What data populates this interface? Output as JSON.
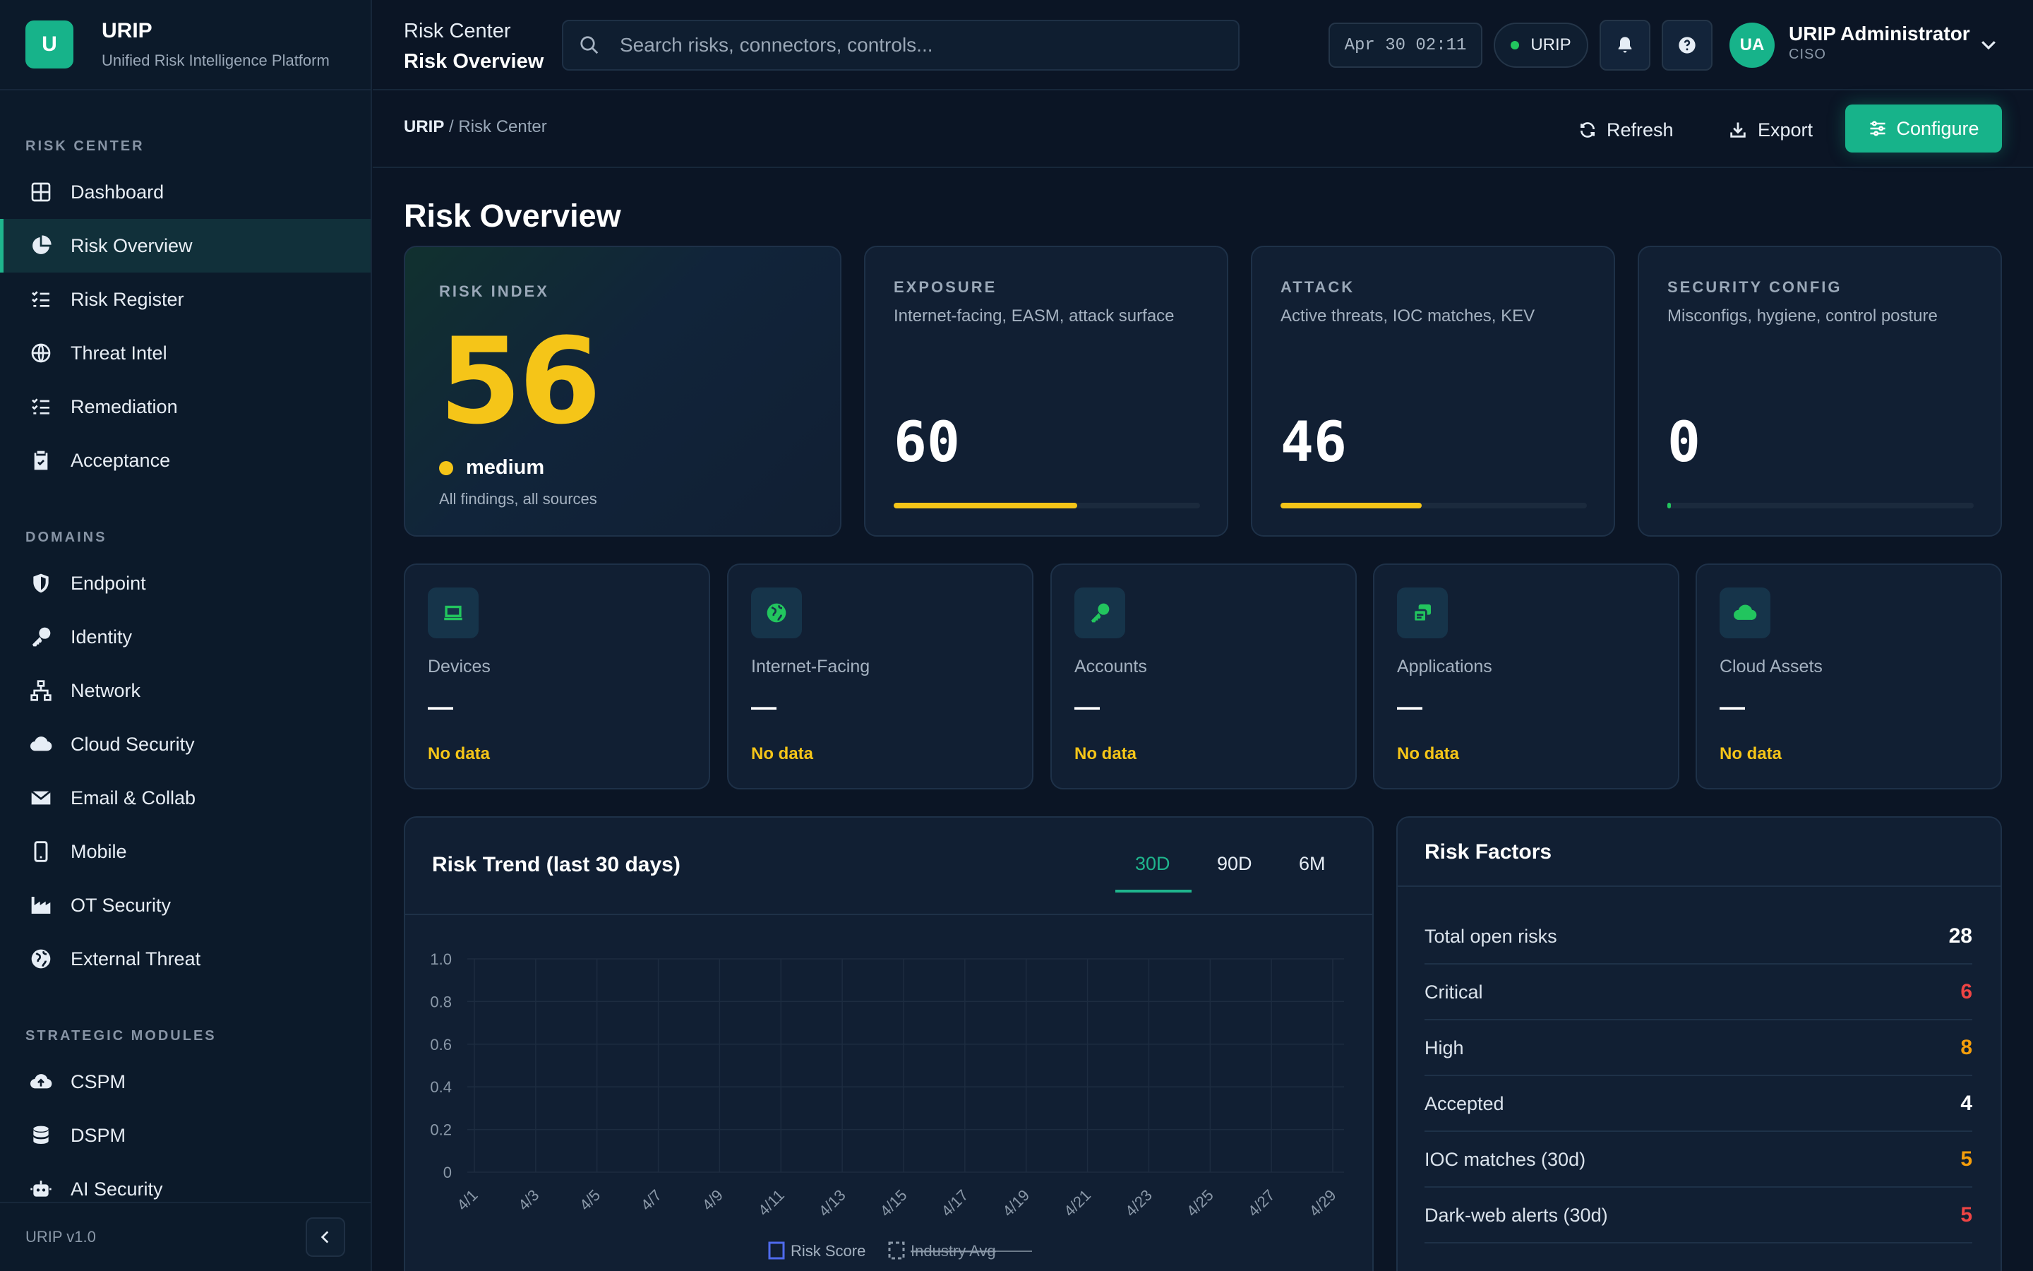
{
  "brand": {
    "logo_letter": "U",
    "name": "URIP",
    "subtitle": "Unified Risk Intelligence Platform"
  },
  "sidebar": {
    "sections": [
      {
        "title": "RISK CENTER",
        "items": [
          "Dashboard",
          "Risk Overview",
          "Risk Register",
          "Threat Intel",
          "Remediation",
          "Acceptance"
        ]
      },
      {
        "title": "DOMAINS",
        "items": [
          "Endpoint",
          "Identity",
          "Network",
          "Cloud Security",
          "Email & Collab",
          "Mobile",
          "OT Security",
          "External Threat"
        ]
      },
      {
        "title": "STRATEGIC MODULES",
        "items": [
          "CSPM",
          "DSPM",
          "AI Security"
        ]
      }
    ],
    "active_item": "Risk Overview",
    "version": "URIP v1.0"
  },
  "topbar": {
    "title_line1": "Risk Center",
    "title_line2": "Risk Overview",
    "search_placeholder": "Search risks, connectors, controls...",
    "datetime": "Apr 30 02:11",
    "tenant": "URIP",
    "user_initials": "UA",
    "user_name": "URIP Administrator",
    "user_role": "CISO"
  },
  "breadcrumb": {
    "root": "URIP",
    "separator": " / ",
    "current": "Risk Center"
  },
  "actions": {
    "refresh": "Refresh",
    "export": "Export",
    "configure": "Configure"
  },
  "page_title": "Risk Overview",
  "risk_index": {
    "label": "RISK INDEX",
    "score": "56",
    "severity": "medium",
    "note": "All findings, all sources",
    "severity_color": "#f5c518"
  },
  "kpis": [
    {
      "label": "EXPOSURE",
      "desc": "Internet-facing, EASM, attack surface",
      "value": "60",
      "progress": 0.6
    },
    {
      "label": "ATTACK",
      "desc": "Active threats, IOC matches, KEV",
      "value": "46",
      "progress": 0.46
    },
    {
      "label": "SECURITY CONFIG",
      "desc": "Misconfigs, hygiene, control posture",
      "value": "0",
      "progress": 0.0
    }
  ],
  "assets": [
    {
      "label": "Devices",
      "value": "—",
      "status": "No data",
      "icon": "laptop-icon"
    },
    {
      "label": "Internet-Facing",
      "value": "—",
      "status": "No data",
      "icon": "globe-icon"
    },
    {
      "label": "Accounts",
      "value": "—",
      "status": "No data",
      "icon": "key-icon"
    },
    {
      "label": "Applications",
      "value": "—",
      "status": "No data",
      "icon": "apps-icon"
    },
    {
      "label": "Cloud Assets",
      "value": "—",
      "status": "No data",
      "icon": "cloud-icon"
    }
  ],
  "trend": {
    "title": "Risk Trend (last 30 days)",
    "ranges": [
      "30D",
      "90D",
      "6M"
    ],
    "active_range": "30D"
  },
  "chart_data": {
    "type": "line",
    "title": "Risk Trend (last 30 days)",
    "x": [
      "4/1",
      "4/3",
      "4/5",
      "4/7",
      "4/9",
      "4/11",
      "4/13",
      "4/15",
      "4/17",
      "4/19",
      "4/21",
      "4/23",
      "4/25",
      "4/27",
      "4/29"
    ],
    "yticks": [
      "0",
      "0.2",
      "0.4",
      "0.6",
      "0.8",
      "1.0"
    ],
    "ylim": [
      0,
      1
    ],
    "series": [
      {
        "name": "Risk Score",
        "values": [],
        "color": "#4f6bed"
      },
      {
        "name": "Industry Avg",
        "values": [],
        "color": "#8a98a8",
        "hidden": true
      }
    ],
    "grid": true,
    "legend": "bottom"
  },
  "risk_factors": {
    "title": "Risk Factors",
    "rows": [
      {
        "label": "Total open risks",
        "value": "28",
        "color": "#ffffff"
      },
      {
        "label": "Critical",
        "value": "6",
        "color": "#ef4444"
      },
      {
        "label": "High",
        "value": "8",
        "color": "#f59e0b"
      },
      {
        "label": "Accepted",
        "value": "4",
        "color": "#ffffff"
      },
      {
        "label": "IOC matches (30d)",
        "value": "5",
        "color": "#f59e0b"
      },
      {
        "label": "Dark-web alerts (30d)",
        "value": "5",
        "color": "#ef4444"
      }
    ]
  }
}
